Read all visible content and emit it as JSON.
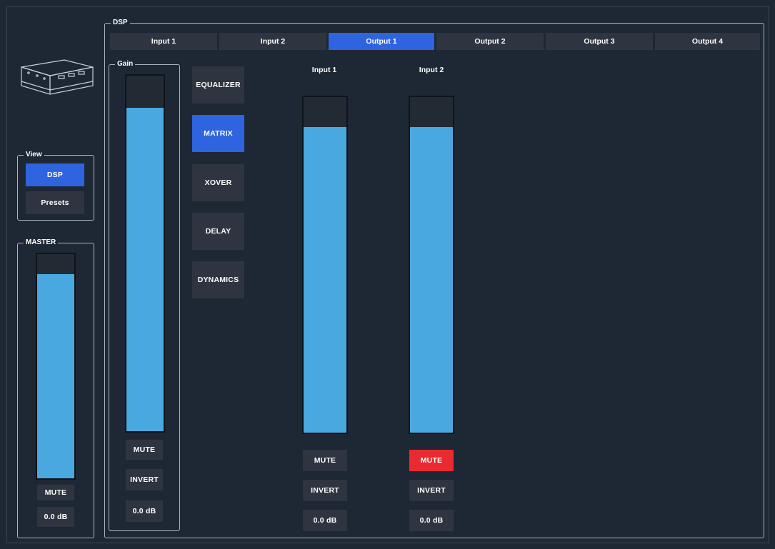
{
  "dsp_group": {
    "title": "DSP"
  },
  "tabs": [
    {
      "label": "Input 1",
      "active": false
    },
    {
      "label": "Input 2",
      "active": false
    },
    {
      "label": "Output 1",
      "active": true
    },
    {
      "label": "Output 2",
      "active": false
    },
    {
      "label": "Output 3",
      "active": false
    },
    {
      "label": "Output 4",
      "active": false
    }
  ],
  "view_group": {
    "title": "View",
    "dsp_label": "DSP",
    "presets_label": "Presets",
    "selected": "DSP"
  },
  "master": {
    "title": "MASTER",
    "level_fraction": 0.91,
    "mute_label": "MUTE",
    "value": "0.0 dB"
  },
  "gain": {
    "title": "Gain",
    "level_fraction": 0.91,
    "mute_label": "MUTE",
    "invert_label": "INVERT",
    "value": "0.0 dB"
  },
  "sections": [
    {
      "label": "EQUALIZER",
      "active": false
    },
    {
      "label": "MATRIX",
      "active": true
    },
    {
      "label": "XOVER",
      "active": false
    },
    {
      "label": "DELAY",
      "active": false
    },
    {
      "label": "DYNAMICS",
      "active": false
    }
  ],
  "matrix_channels": [
    {
      "label": "Input 1",
      "level_fraction": 0.91,
      "mute_label": "MUTE",
      "muted": false,
      "invert_label": "INVERT",
      "value": "0.0 dB"
    },
    {
      "label": "Input 2",
      "level_fraction": 0.91,
      "mute_label": "MUTE",
      "muted": true,
      "invert_label": "INVERT",
      "value": "0.0 dB"
    }
  ],
  "colors": {
    "background": "#1e2734",
    "active": "#2e64df",
    "fader": "#49a8e0",
    "mute_active": "#e92b2f",
    "button": "#2e3540"
  }
}
